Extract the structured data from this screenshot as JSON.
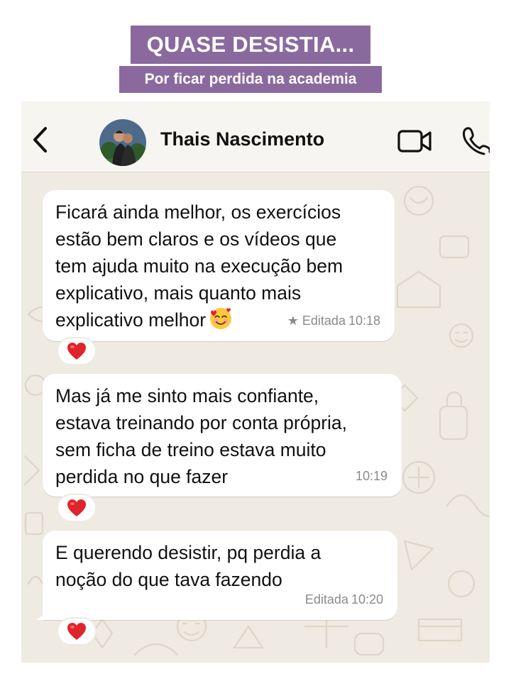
{
  "banner": {
    "headline": "QUASE DESISTIA...",
    "subline": "Por ficar perdida na academia"
  },
  "header": {
    "contact_name": "Thais Nascimento",
    "back_icon": "chevron-left-icon",
    "video_icon": "video-camera-icon",
    "call_icon": "phone-icon"
  },
  "messages": [
    {
      "lines": [
        "Ficará ainda melhor, os exercícios",
        "estão bem claros e os vídeos que",
        "tem ajuda muito na execução bem",
        "explicativo, mais quanto mais",
        "explicativo melhor"
      ],
      "emoji": "smiling-face-with-hearts",
      "status": "★ Editada",
      "time": "10:18",
      "reaction": "❤️"
    },
    {
      "lines": [
        "Mas já me sinto mais confiante,",
        "estava treinando por conta própria,",
        "sem ficha de treino estava muito",
        "perdida no que fazer"
      ],
      "status": "",
      "time": "10:19",
      "reaction": "❤️"
    },
    {
      "lines": [
        "E querendo desistir, pq  perdia a",
        "noção do que tava fazendo"
      ],
      "status": "Editada",
      "time": "10:20",
      "reaction": "❤️"
    }
  ],
  "colors": {
    "banner": "#8a6a9e",
    "chat_background": "#efeae2",
    "bubble": "#ffffff",
    "heart": "#e0242c"
  }
}
